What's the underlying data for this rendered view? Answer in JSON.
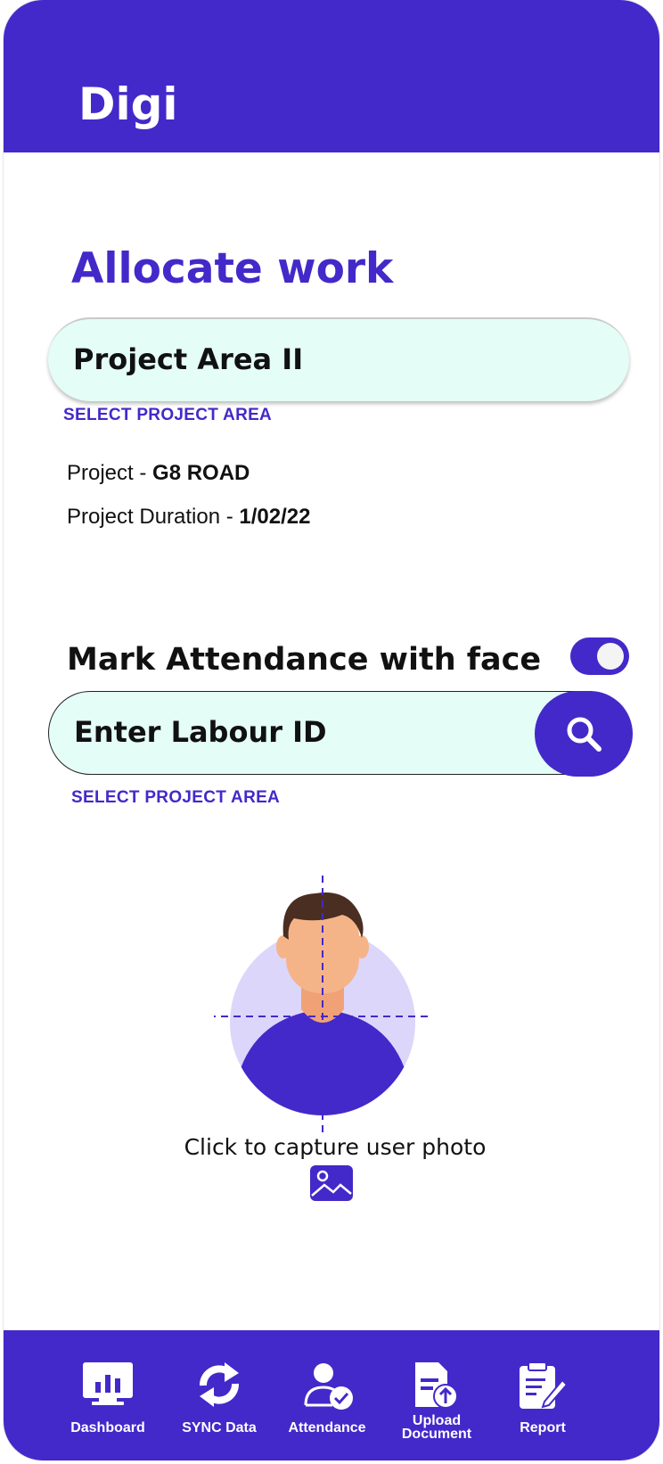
{
  "app": {
    "title": "Digi"
  },
  "page": {
    "title": "Allocate work"
  },
  "project_area": {
    "value": "Project Area II",
    "hint": "SELECT PROJECT AREA"
  },
  "project": {
    "label": "Project - ",
    "name": "G8 ROAD",
    "duration_label": "Project Duration - ",
    "duration": "1/02/22"
  },
  "attendance": {
    "label": "Mark Attendance with face",
    "toggle_on": true,
    "labour_placeholder": "Enter Labour ID",
    "hint": "SELECT PROJECT AREA"
  },
  "capture": {
    "label": "Click to capture user photo"
  },
  "navbar": {
    "items": [
      {
        "label": "Dashboard",
        "icon": "dashboard-icon"
      },
      {
        "label": "SYNC Data",
        "icon": "sync-icon"
      },
      {
        "label": "Attendance",
        "icon": "attendance-icon"
      },
      {
        "label": "Upload Document",
        "icon": "upload-document-icon"
      },
      {
        "label": "Report",
        "icon": "report-icon"
      }
    ]
  },
  "colors": {
    "primary": "#4329c9",
    "field_bg": "#e4fdf6",
    "avatar_bg": "#dcd6fb",
    "skin": "#f5b488",
    "hair": "#4a2e22"
  }
}
